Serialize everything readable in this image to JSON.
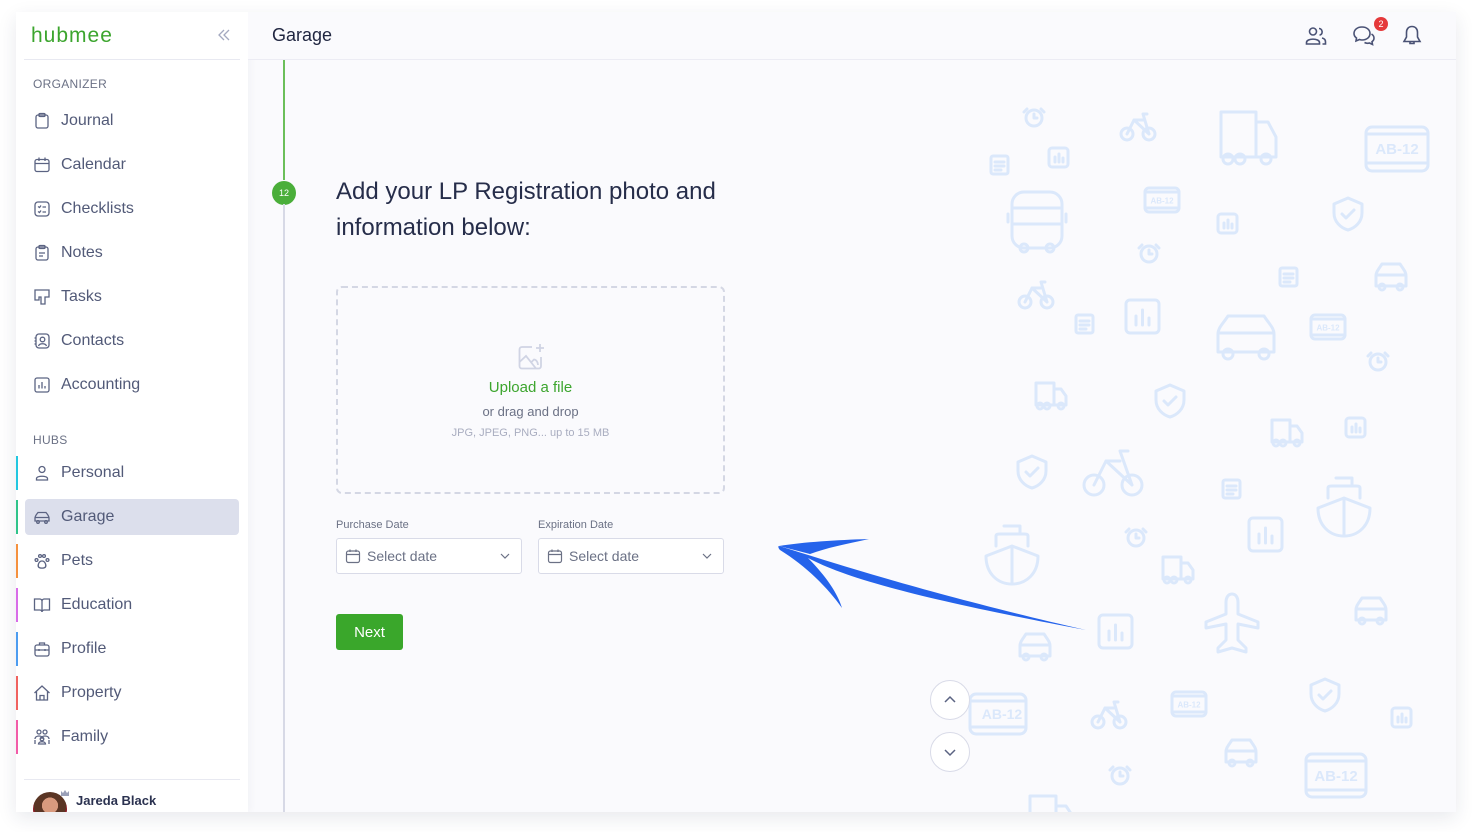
{
  "app": {
    "logo": "hubmee",
    "page_title": "Garage"
  },
  "sidebar": {
    "organizer_label": "ORGANIZER",
    "organizer_items": [
      {
        "label": "Journal",
        "icon": "clipboard-icon"
      },
      {
        "label": "Calendar",
        "icon": "calendar-icon"
      },
      {
        "label": "Checklists",
        "icon": "checklist-icon"
      },
      {
        "label": "Notes",
        "icon": "notes-icon"
      },
      {
        "label": "Tasks",
        "icon": "tasks-icon"
      },
      {
        "label": "Contacts",
        "icon": "contacts-icon"
      },
      {
        "label": "Accounting",
        "icon": "chart-icon"
      }
    ],
    "hubs_label": "HUBS",
    "hub_items": [
      {
        "label": "Personal",
        "icon": "person-icon",
        "color": "#22c7e0",
        "active": false
      },
      {
        "label": "Garage",
        "icon": "car-icon",
        "color": "#2fc48a",
        "active": true
      },
      {
        "label": "Pets",
        "icon": "paw-icon",
        "color": "#f5913e",
        "active": false
      },
      {
        "label": "Education",
        "icon": "book-icon",
        "color": "#d86ce8",
        "active": false
      },
      {
        "label": "Profile",
        "icon": "briefcase-icon",
        "color": "#4c9cf0",
        "active": false
      },
      {
        "label": "Property",
        "icon": "house-icon",
        "color": "#f0625f",
        "active": false
      },
      {
        "label": "Family",
        "icon": "family-icon",
        "color": "#f25ca8",
        "active": false
      }
    ],
    "user": {
      "name": "Jareda Black"
    }
  },
  "header": {
    "messages_badge": "2"
  },
  "step": {
    "number": "12",
    "heading": "Add your LP Registration photo and information below:"
  },
  "upload": {
    "link": "Upload a file",
    "subtext": "or drag and drop",
    "types": "JPG, JPEG, PNG... up to 15 MB"
  },
  "fields": {
    "purchase_label": "Purchase Date",
    "purchase_placeholder": "Select date",
    "expiration_label": "Expiration Date",
    "expiration_placeholder": "Select date"
  },
  "actions": {
    "next": "Next"
  },
  "colors": {
    "brand_green": "#3ca52e",
    "arrow_blue": "#2563eb",
    "badge_red": "#e5393b",
    "bg_icon_blue": "#dbe8fb"
  }
}
